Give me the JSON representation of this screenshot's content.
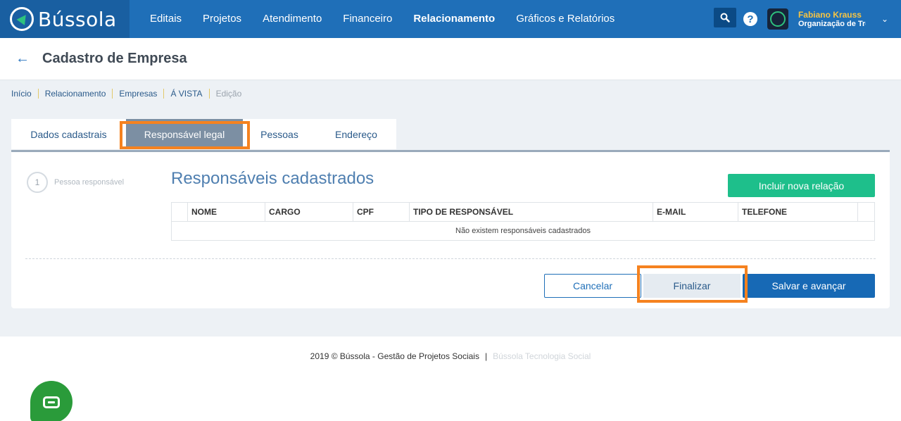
{
  "brand": {
    "name": "Bússola"
  },
  "nav": [
    "Editais",
    "Projetos",
    "Atendimento",
    "Financeiro",
    "Relacionamento",
    "Gráficos e Relatórios"
  ],
  "nav_active": "Relacionamento",
  "user": {
    "name": "Fabiano Krauss",
    "org": "Organização de Tre"
  },
  "page": {
    "title": "Cadastro de Empresa"
  },
  "breadcrumb": [
    "Início",
    "Relacionamento",
    "Empresas",
    "Á VISTA",
    "Edição"
  ],
  "tabs": [
    "Dados cadastrais",
    "Responsável legal",
    "Pessoas",
    "Endereço"
  ],
  "active_tab": "Responsável legal",
  "step": {
    "number": "1",
    "label": "Pessoa responsável"
  },
  "section": {
    "title": "Responsáveis cadastrados",
    "add_button": "Incluir nova relação"
  },
  "table": {
    "columns": [
      "NOME",
      "CARGO",
      "CPF",
      "TIPO DE RESPONSÁVEL",
      "E-MAIL",
      "TELEFONE"
    ],
    "empty_message": "Não existem responsáveis cadastrados"
  },
  "actions": {
    "cancel": "Cancelar",
    "finish": "Finalizar",
    "save": "Salvar e avançar"
  },
  "footer": {
    "copyright": "2019 © Bússola - Gestão de Projetos Sociais",
    "link": "Bússola Tecnologia Social"
  },
  "colors": {
    "primary": "#1f6fb8",
    "accent_green": "#1ebf8b",
    "highlight": "#f5821f",
    "user_name": "#f6c443"
  }
}
